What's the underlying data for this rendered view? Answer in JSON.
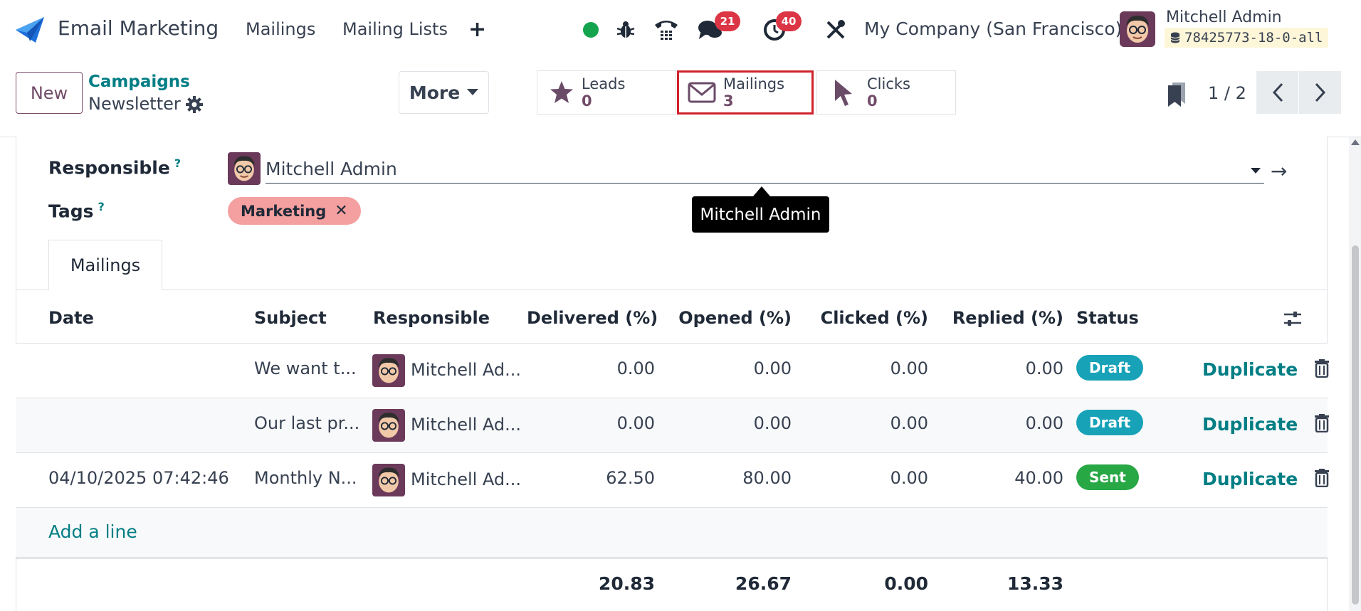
{
  "navbar": {
    "app_name": "Email Marketing",
    "menu": [
      "Mailings",
      "Mailing Lists"
    ],
    "add_label": "+",
    "messages_badge": "21",
    "activities_badge": "40",
    "company": "My Company (San Francisco)",
    "user_name": "Mitchell Admin",
    "database": "78425773-18-0-all",
    "status_color": "#14a44d"
  },
  "control_panel": {
    "new_label": "New",
    "breadcrumb_parent": "Campaigns",
    "breadcrumb_current": "Newsletter",
    "more_label": "More",
    "stats": [
      {
        "label": "Leads",
        "value": "0",
        "icon": "star-icon"
      },
      {
        "label": "Mailings",
        "value": "3",
        "icon": "envelope-icon"
      },
      {
        "label": "Clicks",
        "value": "0",
        "icon": "cursor-icon"
      }
    ],
    "pager": "1 / 2"
  },
  "form": {
    "responsible_label": "Responsible",
    "help_mark": "?",
    "responsible_value": "Mitchell Admin",
    "tags_label": "Tags",
    "tag": "Marketing",
    "tooltip": "Mitchell Admin"
  },
  "tabs": {
    "mailings": "Mailings"
  },
  "table": {
    "headers": [
      "Date",
      "Subject",
      "Responsible",
      "Delivered (%)",
      "Opened (%)",
      "Clicked (%)",
      "Replied (%)",
      "Status"
    ],
    "rows": [
      {
        "date": "",
        "subject": "We want t...",
        "responsible": "Mitchell Ad...",
        "delivered": "0.00",
        "opened": "0.00",
        "clicked": "0.00",
        "replied": "0.00",
        "status": "Draft",
        "action": "Duplicate"
      },
      {
        "date": "",
        "subject": "Our last pr...",
        "responsible": "Mitchell Ad...",
        "delivered": "0.00",
        "opened": "0.00",
        "clicked": "0.00",
        "replied": "0.00",
        "status": "Draft",
        "action": "Duplicate"
      },
      {
        "date": "04/10/2025 07:42:46",
        "subject": "Monthly N...",
        "responsible": "Mitchell Ad...",
        "delivered": "62.50",
        "opened": "80.00",
        "clicked": "0.00",
        "replied": "40.00",
        "status": "Sent",
        "action": "Duplicate"
      }
    ],
    "add_line": "Add a line",
    "totals": {
      "delivered": "20.83",
      "opened": "26.67",
      "clicked": "0.00",
      "replied": "13.33"
    },
    "status_colors": {
      "Draft": "#17a2b8",
      "Sent": "#28a745"
    }
  }
}
